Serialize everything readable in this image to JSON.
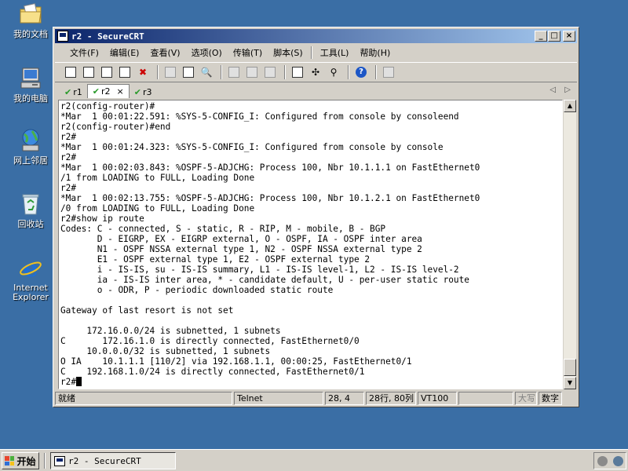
{
  "desktop": {
    "icons": [
      {
        "label": "我的文档",
        "icon": "my-documents-icon"
      },
      {
        "label": "我的电脑",
        "icon": "my-computer-icon"
      },
      {
        "label": "网上邻居",
        "icon": "network-places-icon"
      },
      {
        "label": "回收站",
        "icon": "recycle-bin-icon"
      },
      {
        "label": "Internet Explorer",
        "icon": "internet-explorer-icon"
      }
    ]
  },
  "window": {
    "title": "r2 - SecureCRT",
    "controls": {
      "minimize": "_",
      "maximize": "□",
      "close": "×"
    }
  },
  "menu": {
    "items": [
      "文件(F)",
      "编辑(E)",
      "查看(V)",
      "选项(O)",
      "传输(T)",
      "脚本(S)",
      "工具(L)",
      "帮助(H)"
    ]
  },
  "tabs": {
    "items": [
      {
        "label": "r1",
        "status": "connected"
      },
      {
        "label": "r2",
        "status": "connected",
        "active": true,
        "close": "×"
      },
      {
        "label": "r3",
        "status": "connected"
      }
    ],
    "nav_left": "◁",
    "nav_right": "▷"
  },
  "terminal": {
    "lines": [
      "r2(config-router)#",
      "*Mar  1 00:01:22.591: %SYS-5-CONFIG_I: Configured from console by consoleend",
      "r2(config-router)#end",
      "r2#",
      "*Mar  1 00:01:24.323: %SYS-5-CONFIG_I: Configured from console by console",
      "r2#",
      "*Mar  1 00:02:03.843: %OSPF-5-ADJCHG: Process 100, Nbr 10.1.1.1 on FastEthernet0",
      "/1 from LOADING to FULL, Loading Done",
      "r2#",
      "*Mar  1 00:02:13.755: %OSPF-5-ADJCHG: Process 100, Nbr 10.1.2.1 on FastEthernet0",
      "/0 from LOADING to FULL, Loading Done",
      "r2#show ip route",
      "Codes: C - connected, S - static, R - RIP, M - mobile, B - BGP",
      "       D - EIGRP, EX - EIGRP external, O - OSPF, IA - OSPF inter area",
      "       N1 - OSPF NSSA external type 1, N2 - OSPF NSSA external type 2",
      "       E1 - OSPF external type 1, E2 - OSPF external type 2",
      "       i - IS-IS, su - IS-IS summary, L1 - IS-IS level-1, L2 - IS-IS level-2",
      "       ia - IS-IS inter area, * - candidate default, U - per-user static route",
      "       o - ODR, P - periodic downloaded static route",
      "",
      "Gateway of last resort is not set",
      "",
      "     172.16.0.0/24 is subnetted, 1 subnets",
      "C       172.16.1.0 is directly connected, FastEthernet0/0",
      "     10.0.0.0/32 is subnetted, 1 subnets",
      "O IA    10.1.1.1 [110/2] via 192.168.1.1, 00:00:25, FastEthernet0/1",
      "C    192.168.1.0/24 is directly connected, FastEthernet0/1"
    ],
    "prompt": "r2#"
  },
  "scrollbar": {
    "up": "▲",
    "down": "▼"
  },
  "status": {
    "ready": "就绪",
    "protocol": "Telnet",
    "cursor_pos": "28,  4",
    "size": "28行, 80列",
    "emulation": "VT100",
    "caps": "大写",
    "num": "数字"
  },
  "taskbar": {
    "start": "开始",
    "task_title": "r2 - SecureCRT"
  },
  "colors": {
    "desktop": "#3a6ea5",
    "titlebar_start": "#0a246a",
    "titlebar_end": "#a6caf0",
    "chrome": "#d4d0c8"
  }
}
